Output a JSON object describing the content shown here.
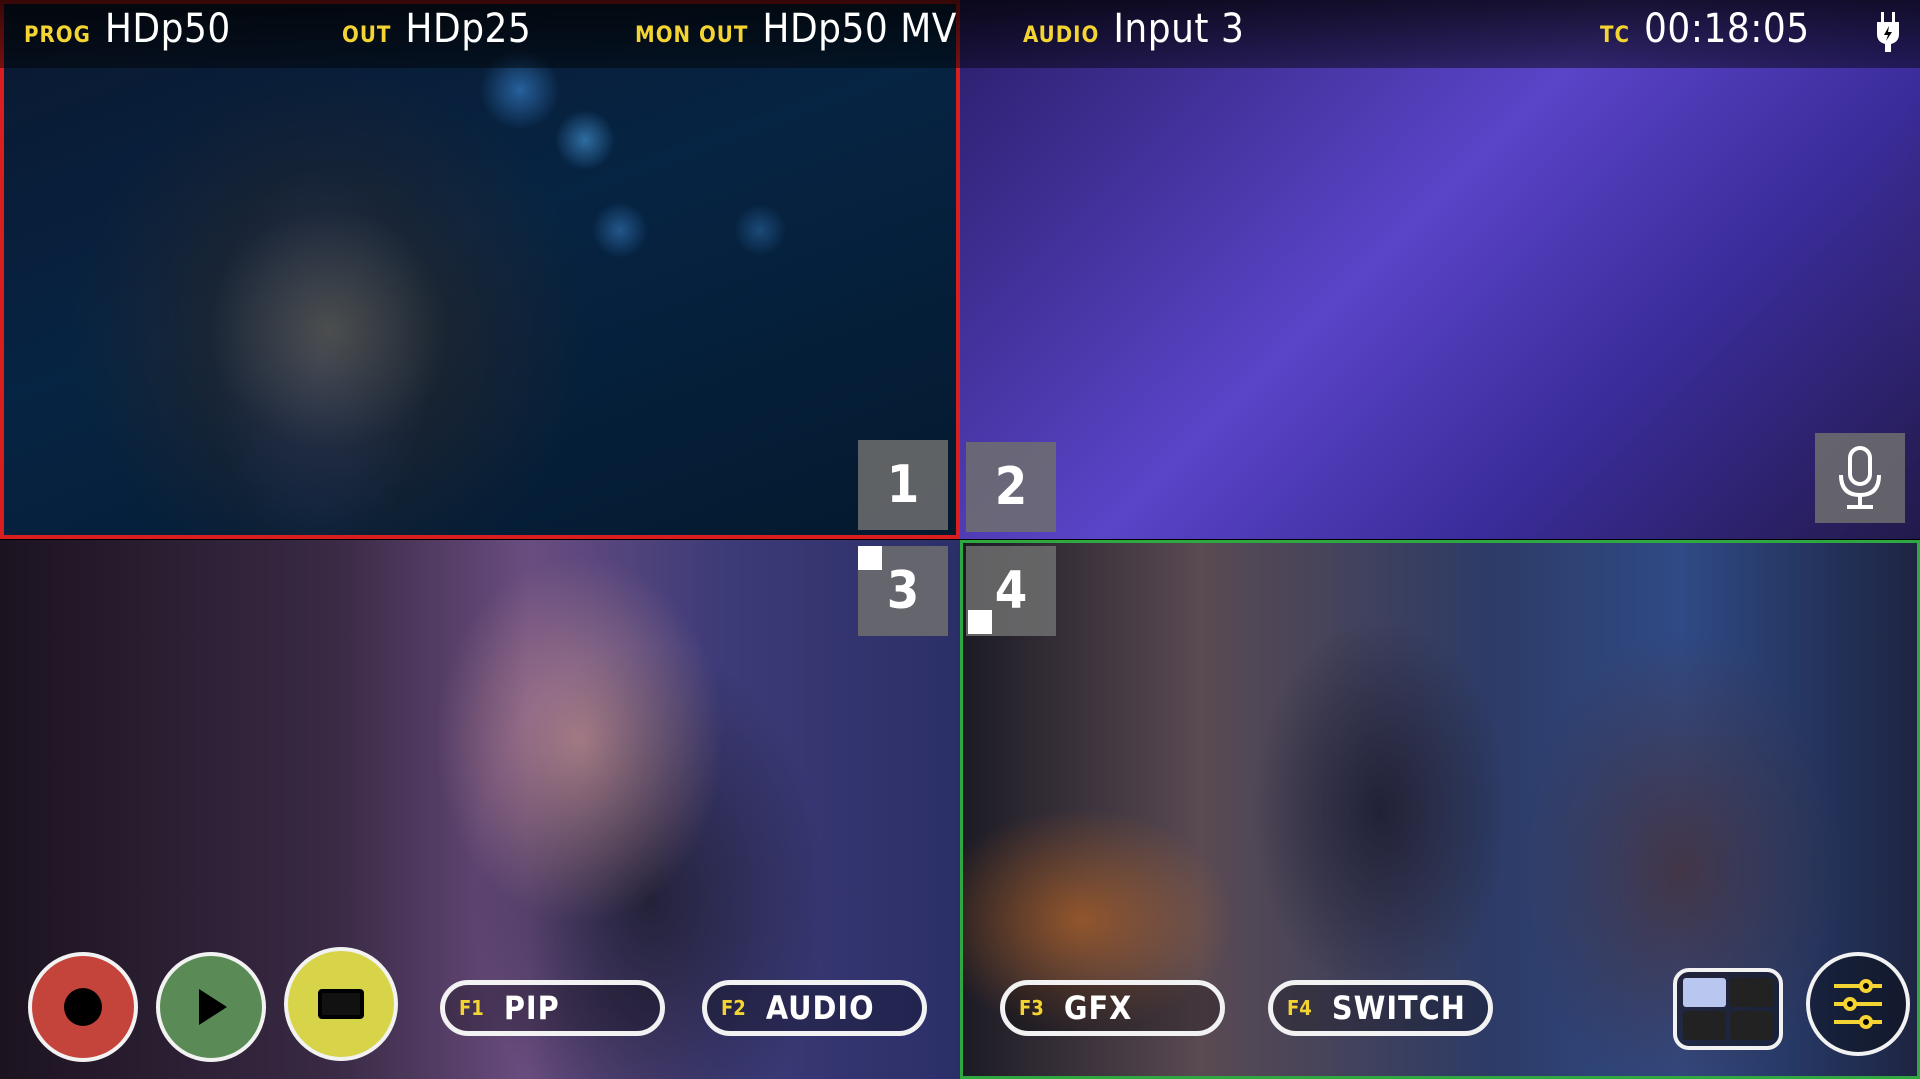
{
  "header": {
    "prog_label": "PROG",
    "prog_value": "HDp50",
    "out_label": "OUT",
    "out_value": "HDp25",
    "mon_out_label": "MON OUT",
    "mon_out_value": "HDp50 MV",
    "audio_label": "AUDIO",
    "audio_value": "Input 3",
    "tc_label": "TC",
    "tc_value": "00:18:05"
  },
  "inputs": [
    "1",
    "2",
    "3",
    "4"
  ],
  "function_buttons": [
    {
      "key": "F1",
      "label": "PIP"
    },
    {
      "key": "F2",
      "label": "AUDIO"
    },
    {
      "key": "F3",
      "label": "GFX"
    },
    {
      "key": "F4",
      "label": "SWITCH"
    }
  ],
  "icons": {
    "power": "power-plug-icon",
    "mic": "microphone-icon",
    "record": "record-icon",
    "play": "play-icon",
    "stop": "stop-icon",
    "layout": "quad-layout-icon",
    "settings": "sliders-icon"
  },
  "colors": {
    "program_border": "#d81e1e",
    "preview_border": "#2fa842",
    "label_yellow": "#f4d432",
    "record": "#c4443c",
    "play": "#5a8a55",
    "stop": "#d8d44a"
  }
}
